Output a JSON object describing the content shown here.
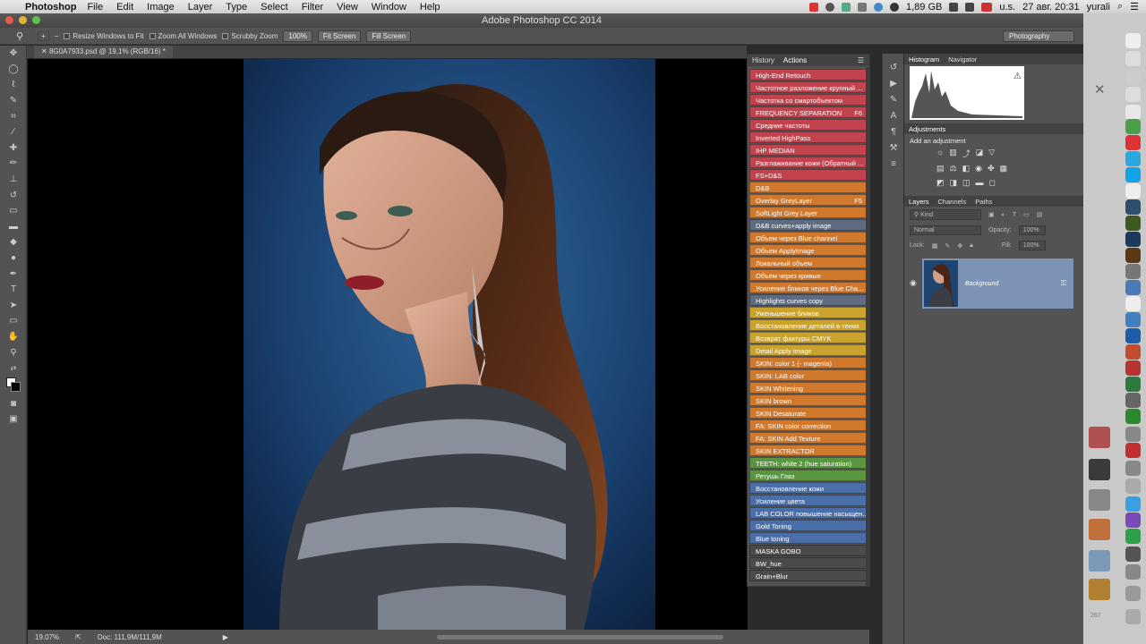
{
  "menubar": {
    "app": "Photoshop",
    "items": [
      "File",
      "Edit",
      "Image",
      "Layer",
      "Type",
      "Select",
      "Filter",
      "View",
      "Window",
      "Help"
    ],
    "memory": "1,89 GB",
    "locale": "u.s.",
    "datetime": "27 авг. 20:31",
    "user": "yurali"
  },
  "window": {
    "title": "Adobe Photoshop CC 2014"
  },
  "options": {
    "resize_fit": "Resize Windows to Fit",
    "zoom_all": "Zoom All Windows",
    "scrubby": "Scrubby Zoom",
    "zoom_100": "100%",
    "fit_screen": "Fit Screen",
    "fill_screen": "Fill Screen",
    "workspace": "Photography"
  },
  "document": {
    "tab": "8G0A7933.psd @ 19,1% (RGB/16) *"
  },
  "status": {
    "zoom": "19.07%",
    "doc": "Doc: 111,9M/111,9M"
  },
  "actions_panel": {
    "tabs": [
      "History",
      "Actions"
    ],
    "items": [
      {
        "label": "High-End Retouch",
        "key": "",
        "color": "#c0434e"
      },
      {
        "label": "Частотное разложение крупный ...",
        "key": "",
        "color": "#c0434e"
      },
      {
        "label": "Частотка со смартобъектом",
        "key": "",
        "color": "#c0434e"
      },
      {
        "label": "FREQUENCY SEPARATION",
        "key": "F6",
        "color": "#c0434e"
      },
      {
        "label": "Средние частоты",
        "key": "",
        "color": "#c0434e"
      },
      {
        "label": "Inverted HighPass",
        "key": "",
        "color": "#c0434e"
      },
      {
        "label": "IHP MEDIAN",
        "key": "",
        "color": "#c0434e"
      },
      {
        "label": "Разглаживание кожи (Обратный ...",
        "key": "",
        "color": "#c0434e"
      },
      {
        "label": "FS+D&S",
        "key": "",
        "color": "#c0434e"
      },
      {
        "label": "D&B",
        "key": "",
        "color": "#d0782b"
      },
      {
        "label": "Overlay GreyLayer",
        "key": "F5",
        "color": "#d0782b"
      },
      {
        "label": "SoftLight Grey Layer",
        "key": "",
        "color": "#d0782b"
      },
      {
        "label": "D&B curves+apply image",
        "key": "",
        "color": "#5e6b80"
      },
      {
        "label": "Объем через Blue channel",
        "key": "",
        "color": "#d0782b"
      },
      {
        "label": "Объем ApplyImage",
        "key": "",
        "color": "#d0782b"
      },
      {
        "label": "Локальный объем",
        "key": "",
        "color": "#d0782b"
      },
      {
        "label": "Объем через кривые",
        "key": "",
        "color": "#d0782b"
      },
      {
        "label": "Усиление бликов через Blue Cha...",
        "key": "",
        "color": "#d0782b"
      },
      {
        "label": "Highlights curves copy",
        "key": "",
        "color": "#5e6b80"
      },
      {
        "label": "Уменьшение бликов",
        "key": "",
        "color": "#c9a32d"
      },
      {
        "label": "Восстановление деталей в тенях",
        "key": "",
        "color": "#c9a32d"
      },
      {
        "label": "Возврат фактуры CMYK",
        "key": "",
        "color": "#c9a32d"
      },
      {
        "label": "Detail Apply Image",
        "key": "",
        "color": "#c9a32d"
      },
      {
        "label": "SKIN: color 1 (- magenta)",
        "key": "",
        "color": "#d0782b"
      },
      {
        "label": "SKIN: LAB color",
        "key": "",
        "color": "#d0782b"
      },
      {
        "label": "SKIN Whitening",
        "key": "",
        "color": "#d0782b"
      },
      {
        "label": "SKIN brown",
        "key": "",
        "color": "#d0782b"
      },
      {
        "label": "SKIN Desaturate",
        "key": "",
        "color": "#d0782b"
      },
      {
        "label": "FA: SKIN color correction",
        "key": "",
        "color": "#d0782b"
      },
      {
        "label": "FA: SKIN Add Texture",
        "key": "",
        "color": "#d0782b"
      },
      {
        "label": "SKIN EXTRACTOR",
        "key": "",
        "color": "#d0782b"
      },
      {
        "label": "TEETH: white 2 (hue saturation)",
        "key": "",
        "color": "#5a963f"
      },
      {
        "label": "Ретушь Глаз",
        "key": "",
        "color": "#5a963f"
      },
      {
        "label": "Восстановление кожи",
        "key": "",
        "color": "#4a6fa8"
      },
      {
        "label": "Усиление цвета",
        "key": "",
        "color": "#4a6fa8"
      },
      {
        "label": "LAB COLOR повышение насыщен...",
        "key": "",
        "color": "#4a6fa8"
      },
      {
        "label": "Gold Toning",
        "key": "",
        "color": "#4a6fa8"
      },
      {
        "label": "Blue toning",
        "key": "",
        "color": "#4a6fa8"
      },
      {
        "label": "MASKA GOBO",
        "key": "",
        "color": "#4b4b4b"
      },
      {
        "label": "BW_hue",
        "key": "",
        "color": "#4b4b4b"
      },
      {
        "label": "Grain+Blur",
        "key": "",
        "color": "#4b4b4b"
      }
    ]
  },
  "histogram_panel": {
    "tabs": [
      "Histogram",
      "Navigator"
    ]
  },
  "adjustments_panel": {
    "title": "Adjustments",
    "subtitle": "Add an adjustment"
  },
  "layers_panel": {
    "tabs": [
      "Layers",
      "Channels",
      "Paths"
    ],
    "kind": "Kind",
    "blend": "Normal",
    "opacity_label": "Opacity:",
    "opacity": "100%",
    "lock_label": "Lock:",
    "fill_label": "Fill:",
    "fill": "100%",
    "layer_name": "Background"
  },
  "dock": {
    "badge": "267"
  }
}
